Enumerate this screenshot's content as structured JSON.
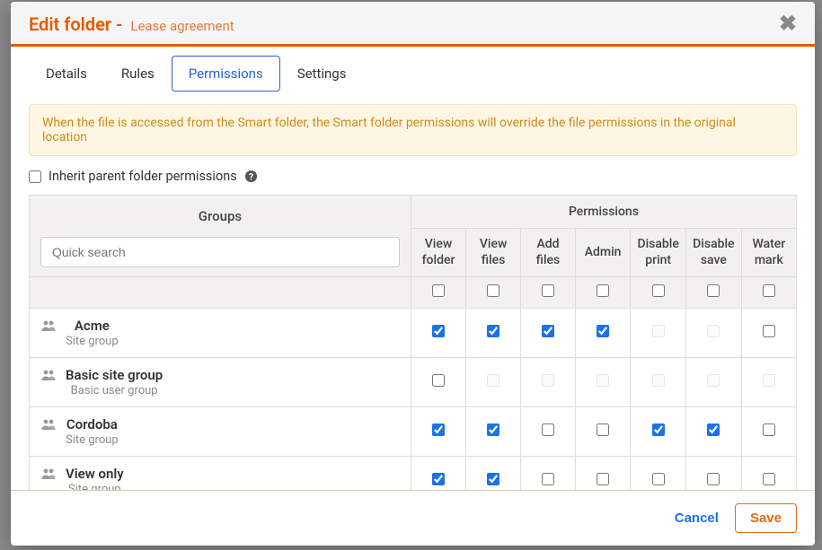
{
  "header": {
    "title_prefix": "Edit folder - ",
    "folder_name": "Lease agreement"
  },
  "tabs": [
    {
      "label": "Details",
      "active": false
    },
    {
      "label": "Rules",
      "active": false
    },
    {
      "label": "Permissions",
      "active": true
    },
    {
      "label": "Settings",
      "active": false
    }
  ],
  "notice": "When the file is accessed from the Smart folder, the Smart folder permissions will override the file permissions in the original location",
  "inherit": {
    "label": "Inherit parent folder permissions",
    "checked": false
  },
  "table": {
    "groups_header": "Groups",
    "permissions_header": "Permissions",
    "search_placeholder": "Quick search",
    "columns": [
      "View folder",
      "View files",
      "Add files",
      "Admin",
      "Disable print",
      "Disable save",
      "Water mark"
    ],
    "column_header_checks": [
      false,
      false,
      false,
      false,
      false,
      false,
      false
    ],
    "rows": [
      {
        "name": "Acme",
        "subtitle": "Site group",
        "cells": [
          {
            "checked": true,
            "disabled": false
          },
          {
            "checked": true,
            "disabled": false
          },
          {
            "checked": true,
            "disabled": false
          },
          {
            "checked": true,
            "disabled": false
          },
          {
            "checked": false,
            "disabled": true
          },
          {
            "checked": false,
            "disabled": true
          },
          {
            "checked": false,
            "disabled": false
          }
        ]
      },
      {
        "name": "Basic site group",
        "subtitle": "Basic user group",
        "cells": [
          {
            "checked": false,
            "disabled": false
          },
          {
            "checked": false,
            "disabled": true
          },
          {
            "checked": false,
            "disabled": true
          },
          {
            "checked": false,
            "disabled": true
          },
          {
            "checked": false,
            "disabled": true
          },
          {
            "checked": false,
            "disabled": true
          },
          {
            "checked": false,
            "disabled": true
          }
        ]
      },
      {
        "name": "Cordoba",
        "subtitle": "Site group",
        "cells": [
          {
            "checked": true,
            "disabled": false
          },
          {
            "checked": true,
            "disabled": false
          },
          {
            "checked": false,
            "disabled": false
          },
          {
            "checked": false,
            "disabled": false
          },
          {
            "checked": true,
            "disabled": false
          },
          {
            "checked": true,
            "disabled": false
          },
          {
            "checked": false,
            "disabled": false
          }
        ]
      },
      {
        "name": "View only",
        "subtitle": "Site group",
        "cells": [
          {
            "checked": true,
            "disabled": false
          },
          {
            "checked": true,
            "disabled": false
          },
          {
            "checked": false,
            "disabled": false
          },
          {
            "checked": false,
            "disabled": false
          },
          {
            "checked": false,
            "disabled": false
          },
          {
            "checked": false,
            "disabled": false
          },
          {
            "checked": false,
            "disabled": false
          }
        ]
      }
    ]
  },
  "footer": {
    "cancel": "Cancel",
    "save": "Save"
  }
}
